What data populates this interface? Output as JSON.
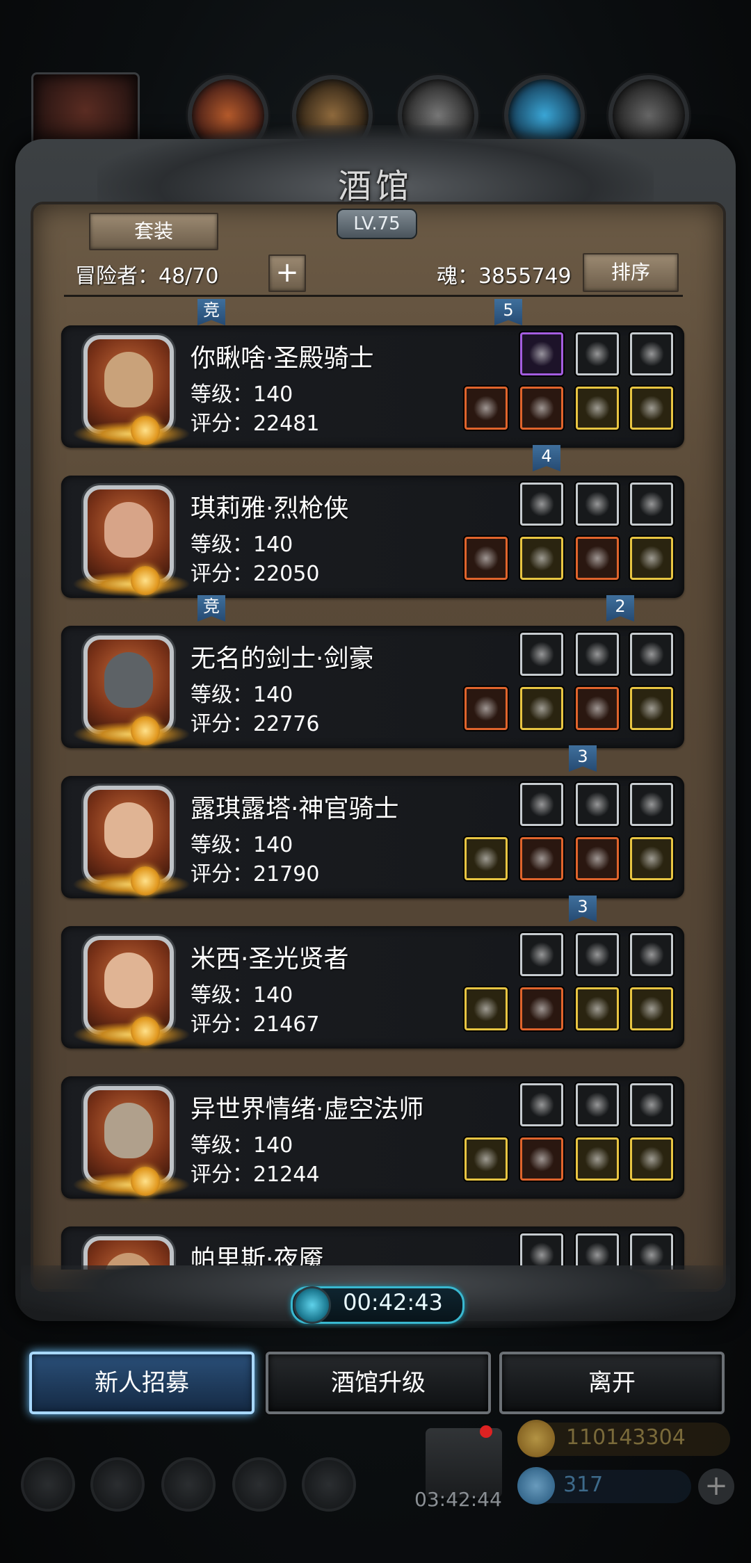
{
  "title": "酒馆",
  "level_badge": "LV.75",
  "set_button": "套装",
  "sort_button": "排序",
  "plus_symbol": "+",
  "adventurers": "冒险者：48/70",
  "soul": "魂：3855749",
  "heroes": [
    {
      "name": "你瞅啥·圣殿骑士",
      "level": "等级：140",
      "score": "评分：22481",
      "face_color": "#c9a27a"
    },
    {
      "name": "琪莉雅·烈枪侠",
      "level": "等级：140",
      "score": "评分：22050",
      "face_color": "#d7a488"
    },
    {
      "name": "无名的剑士·剑豪",
      "level": "等级：140",
      "score": "评分：22776",
      "face_color": "#5d6266"
    },
    {
      "name": "露琪露塔·神官骑士",
      "level": "等级：140",
      "score": "评分：21790",
      "face_color": "#e0b494"
    },
    {
      "name": "米西·圣光贤者",
      "level": "等级：140",
      "score": "评分：21467",
      "face_color": "#e0b494"
    },
    {
      "name": "异世界情绪·虚空法师",
      "level": "等级：140",
      "score": "评分：21244",
      "face_color": "#b0a08c"
    },
    {
      "name": "帕里斯·夜魇",
      "level": "",
      "score": "",
      "face_color": "#c89a72"
    }
  ],
  "ribbons": {
    "r1": "竞",
    "r2": "5",
    "r3": "4",
    "r4": "竞",
    "r5": "2",
    "r6": "3",
    "r7": "3"
  },
  "timer": "00:42:43",
  "buttons": {
    "recruit": "新人招募",
    "upgrade": "酒馆升级",
    "leave": "离开"
  },
  "background": {
    "gift_timer": "03:42:44",
    "gold": "110143304",
    "gems": "317",
    "plus": "+"
  }
}
